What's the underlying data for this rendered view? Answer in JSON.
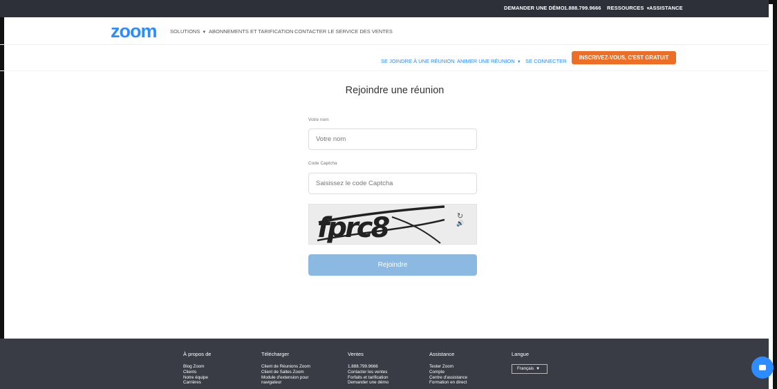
{
  "topbar": {
    "demo": "DEMANDER UNE DÉMO",
    "phone": "1.888.799.9666",
    "resources": "RESSOURCES",
    "support": "ASSISTANCE"
  },
  "mainnav": {
    "logo": "zoom",
    "solutions": "SOLUTIONS",
    "pricing": "ABONNEMENTS ET TARIFICATION",
    "contact_sales": "CONTACTER LE SERVICE DES VENTES"
  },
  "subnav": {
    "join": "SE JOINDRE À UNE RÉUNION",
    "host": "ANIMER UNE RÉUNION",
    "signin": "SE CONNECTER",
    "signup": "INSCRIVEZ-VOUS, C'EST GRATUIT"
  },
  "form": {
    "title": "Rejoindre une réunion",
    "name_label": "Votre nom",
    "name_placeholder": "Votre nom",
    "captcha_label": "Code Captcha",
    "captcha_placeholder": "Saisissez le code Captcha",
    "captcha_text": "fprc8",
    "join_button": "Rejoindre"
  },
  "footer": {
    "about": {
      "heading": "À propos de",
      "items": [
        "Blog Zoom",
        "Clients",
        "Notre équipe",
        "Carrières"
      ]
    },
    "download": {
      "heading": "Télécharger",
      "items": [
        "Client de Réunions Zoom",
        "Client de Salles Zoom",
        "Module d'extension pour",
        "navigateur"
      ]
    },
    "sales": {
      "heading": "Ventes",
      "items": [
        "1.888.799.9666",
        "Contacter les ventes",
        "Forfaits et tarification",
        "Demander une démo"
      ]
    },
    "support": {
      "heading": "Assistance",
      "items": [
        "Tester Zoom",
        "Compte",
        "Centre d'assistance",
        "Formation en direct"
      ]
    },
    "language": {
      "heading": "Langue",
      "selected": "Français"
    }
  },
  "colors": {
    "brand_blue": "#2d8cff",
    "signup_orange": "#ed6e25",
    "topbar_bg": "#2d3039",
    "footer_bg": "#393c45",
    "join_button_disabled": "#8bb9e1"
  },
  "icons": {
    "refresh": "refresh-icon",
    "audio": "audio-icon",
    "chat": "chat-icon",
    "caret": "chevron-down-icon"
  }
}
